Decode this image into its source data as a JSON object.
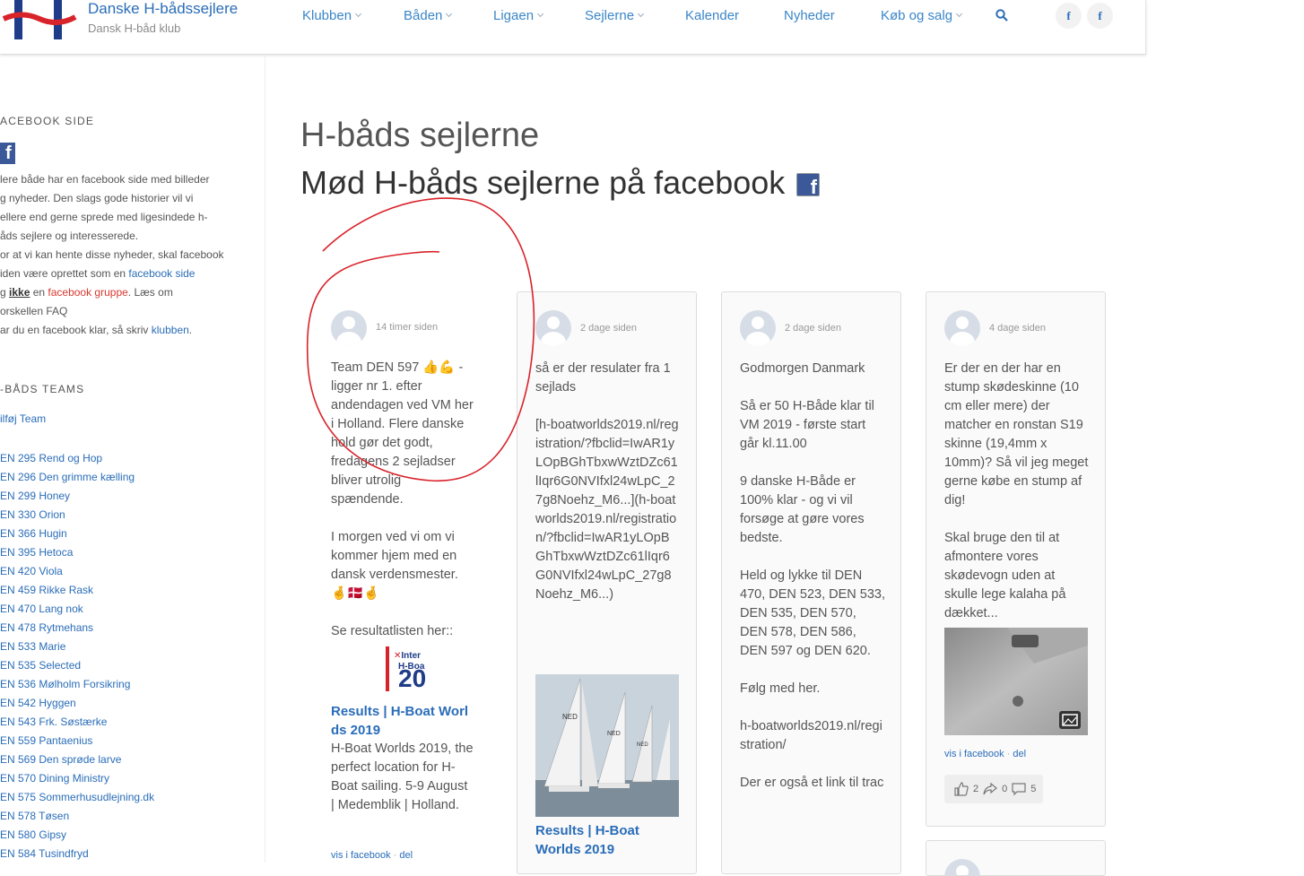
{
  "header": {
    "brand_title": "Danske H-bådssejlere",
    "brand_sub": "Dansk H-båd klub",
    "nav": [
      {
        "label": "Klubben",
        "dropdown": true
      },
      {
        "label": "Båden",
        "dropdown": true
      },
      {
        "label": "Ligaen",
        "dropdown": true
      },
      {
        "label": "Sejlerne",
        "dropdown": true
      },
      {
        "label": "Kalender",
        "dropdown": false
      },
      {
        "label": "Nyheder",
        "dropdown": false
      },
      {
        "label": "Køb og salg",
        "dropdown": true
      }
    ],
    "social": [
      "f",
      "f"
    ]
  },
  "sidebar": {
    "fb_heading": "ACEBOOK SIDE",
    "text": {
      "l1": "lere både har en  facebook side med billeder",
      "l2": "g nyheder. Den slags gode historier  vil vi",
      "l3": "ellere end gerne sprede med  ligesindede h-",
      "l4": "åds sejlere og interesserede.",
      "l5": "or at vi kan hente disse nyheder, skal facebook",
      "l6a": "iden være oprettet som en ",
      "l6b": "facebook side",
      "l7a": "g  ",
      "l7b": "ikke",
      "l7c": "  en ",
      "l7d": "facebook gruppe",
      "l7e": ".  Læs om",
      "l8": "orskellen FAQ",
      "l9a": "ar du en facebook klar, så skriv ",
      "l9b": "klubben",
      "l9c": "."
    },
    "teams_heading": "-BÅDS TEAMS",
    "add_team": "ilføj Team",
    "teams": [
      "EN 295 Rend og Hop",
      "EN 296 Den grimme kælling",
      "EN 299 Honey",
      "EN 330 Orion",
      "EN 366 Hugin",
      "EN 395 Hetoca",
      "EN 420 Viola",
      "EN 459 Rikke Rask",
      "EN 470 Lang nok",
      "EN 478 Rytmehans",
      "EN 533 Marie",
      "EN 535 Selected",
      "EN 536 Mølholm Forsikring",
      "EN 542 Hyggen",
      "EN 543 Frk. Søstærke",
      "EN 559 Pantaenius",
      "EN 569 Den sprøde larve",
      "EN 570 Dining Ministry",
      "EN 575 Sommerhusudlejning.dk",
      "EN 578 Tøsen",
      "EN 580 Gipsy",
      "EN 584 Tusindfryd"
    ]
  },
  "main": {
    "title": "H-båds sejlerne",
    "subtitle": "Mød H-båds sejlerne på facebook",
    "posts": [
      {
        "time": "14 timer siden",
        "p1": "Team DEN 597 👍💪 - ligger nr 1. efter andendagen ved VM her i Holland. Flere danske hold gør det godt, fredagens 2 sejladser bliver utrolig spændende.",
        "p2": "I morgen ved vi om vi kommer hjem med en dansk verdensmester. 🤞🇩🇰🤞",
        "p3": "Se resultatlisten her::",
        "thumb_text_a": "Inter",
        "thumb_text_b": "H-Boa",
        "thumb_text_c": "20",
        "link_title": "Results | H-Boat Worlds 2019",
        "link_desc": "H-Boat Worlds 2019, the perfect location for H-Boat sailing. 5-9 August | Medemblik | Holland.",
        "footer_view": "vis i facebook",
        "footer_share": "del"
      },
      {
        "time": "2 dage siden",
        "p1": "så er der resulater fra 1 sejlads",
        "p2": "[h-boatworlds2019.nl/registration/?fbclid=IwAR1yLOpBGhTbxwWztDZc61lIqr6G0NVIfxl24wLpC_27g8Noehz_M6...](h-boatworlds2019.nl/registration/?fbclid=IwAR1yLOpBGhTbxwWztDZc61lIqr6G0NVIfxl24wLpC_27g8Noehz_M6...)",
        "sail_a": "NED",
        "sail_b": "NED",
        "sail_c": "NED",
        "link_title": "Results | H-Boat Worlds 2019"
      },
      {
        "time": "2 dage siden",
        "p1": "Godmorgen Danmark",
        "p2": "Så er 50 H-Både klar til VM 2019 - første start går kl.11.00",
        "p3": "9 danske H-Både er 100% klar - og vi vil forsøge at gøre vores bedste.",
        "p4": "Held og lykke til DEN 470, DEN 523, DEN 533, DEN 535, DEN 570, DEN 578, DEN 586, DEN 597 og DEN 620.",
        "p5": "Følg med her.",
        "p6": "h-boatworlds2019.nl/registration/",
        "p7": "Der er også et link til trac"
      },
      {
        "time": "4 dage siden",
        "p1": "Er der en der har en stump skødeskinne (10 cm eller mere) der matcher en ronstan S19 skinne (19,4mm x 10mm)? Så vil jeg meget gerne købe en stump af dig!",
        "p2": "Skal bruge den til at afmontere vores skødevogn uden at skulle lege kalaha på dækket...",
        "footer_view": "vis i facebook",
        "footer_share": "del",
        "likes": "2",
        "shares": "0",
        "comments": "5"
      }
    ]
  }
}
